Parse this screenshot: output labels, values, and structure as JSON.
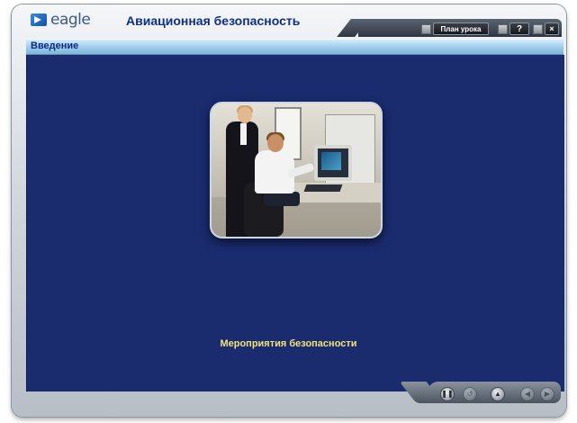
{
  "app": {
    "logo_text": "eagle",
    "title": "Авиационная безопасность"
  },
  "toolbar": {
    "lesson_plan_label": "План урока",
    "help_label": "?",
    "close_label": "×"
  },
  "section": {
    "title": "Введение"
  },
  "slide": {
    "caption": "Мероприятия безопасности"
  },
  "navigation": {
    "pause_icon": "pause-icon",
    "back_icon": "back-icon",
    "home_icon": "home-icon",
    "prev_icon": "prev-icon",
    "next_icon": "next-icon"
  },
  "colors": {
    "stage_bg": "#1a2b6e",
    "title_text": "#0d2f86",
    "caption_text": "#f4e27a",
    "section_bar": "#9ccbe9"
  }
}
